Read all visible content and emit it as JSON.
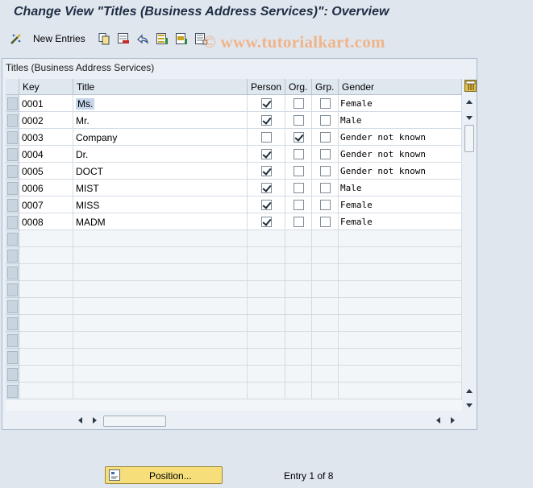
{
  "window": {
    "title": "Change View \"Titles (Business Address Services)\": Overview"
  },
  "toolbar": {
    "new_entries_label": "New Entries",
    "watermark": "© www.tutorialkart.com",
    "icons": [
      "edit-toggle-icon",
      "copy-icon",
      "delete-icon",
      "undo-icon",
      "select-all-icon",
      "select-block-icon",
      "deselect-all-icon"
    ]
  },
  "panel": {
    "title": "Titles (Business Address Services)"
  },
  "table": {
    "columns": [
      "Key",
      "Title",
      "Person",
      "Org.",
      "Grp.",
      "Gender"
    ],
    "rows": [
      {
        "key": "0001",
        "title": "Ms.",
        "person": true,
        "org": false,
        "grp": false,
        "gender": "Female"
      },
      {
        "key": "0002",
        "title": "Mr.",
        "person": true,
        "org": false,
        "grp": false,
        "gender": "Male"
      },
      {
        "key": "0003",
        "title": "Company",
        "person": false,
        "org": true,
        "grp": false,
        "gender": "Gender not known"
      },
      {
        "key": "0004",
        "title": "Dr.",
        "person": true,
        "org": false,
        "grp": false,
        "gender": "Gender not known"
      },
      {
        "key": "0005",
        "title": "DOCT",
        "person": true,
        "org": false,
        "grp": false,
        "gender": "Gender not known"
      },
      {
        "key": "0006",
        "title": "MIST",
        "person": true,
        "org": false,
        "grp": false,
        "gender": "Male"
      },
      {
        "key": "0007",
        "title": "MISS",
        "person": true,
        "org": false,
        "grp": false,
        "gender": "Female"
      },
      {
        "key": "0008",
        "title": "MADM",
        "person": true,
        "org": false,
        "grp": false,
        "gender": "Female"
      }
    ]
  },
  "footer": {
    "position_label": "Position...",
    "entry_text": "Entry 1 of 8"
  },
  "colors": {
    "background": "#dfe6ee",
    "title_text": "#1f2d44",
    "position_button": "#f6df7a",
    "watermark": "#f0b48a"
  }
}
